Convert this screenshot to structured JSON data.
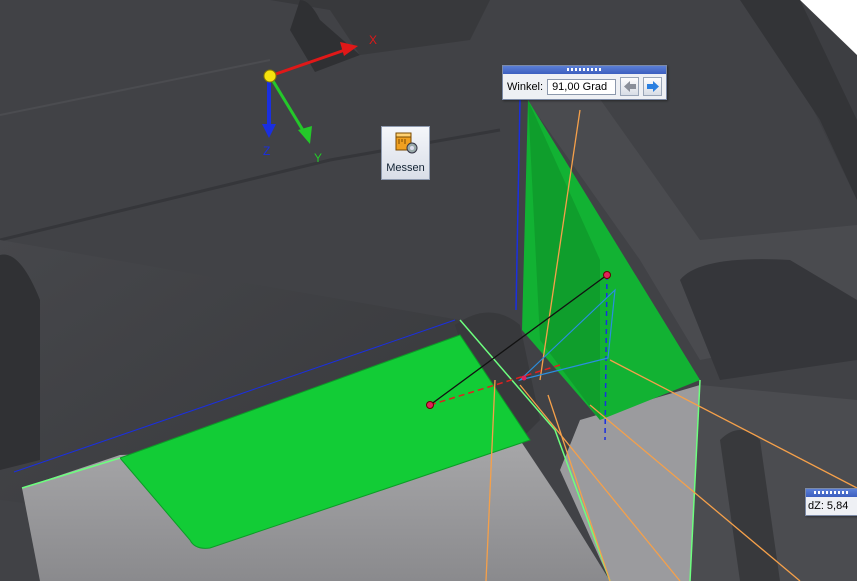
{
  "axes": {
    "x_label": "X",
    "y_label": "Y",
    "z_label": "Z"
  },
  "measure_tool": {
    "label": "Messen",
    "icon": "ruler-measure-icon"
  },
  "angle_dialog": {
    "label": "Winkel:",
    "value": "91,00 Grad"
  },
  "dz_dialog": {
    "label": "dZ:",
    "value": "5,84"
  },
  "colors": {
    "accent": "#3c5fbf",
    "selection": "#12cc36",
    "background": "#3d3e42"
  }
}
